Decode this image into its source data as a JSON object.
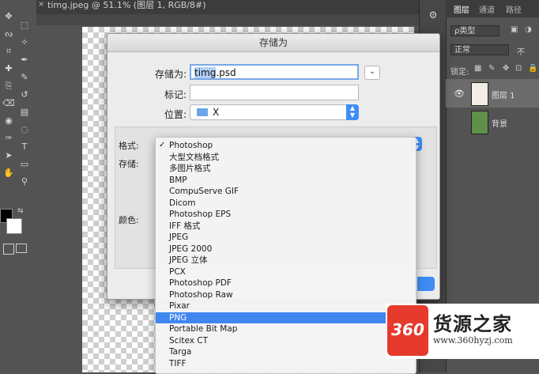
{
  "document": {
    "tab_label": "timg.jpeg @ 51.1% (图层 1, RGB/8#)"
  },
  "toolbar": {
    "tools": [
      "move-icon",
      "marquee-icon",
      "lasso-icon",
      "magic-wand-icon",
      "crop-icon",
      "eyedropper-icon",
      "healing-icon",
      "brush-icon",
      "stamp-icon",
      "history-brush-icon",
      "eraser-icon",
      "gradient-icon",
      "blur-icon",
      "dodge-icon",
      "pen-icon",
      "type-icon",
      "path-select-icon",
      "rectangle-icon",
      "hand-icon",
      "zoom-icon"
    ],
    "foreground_color": "#000000",
    "background_color": "#ffffff"
  },
  "layers_panel": {
    "tabs": [
      "图层",
      "通道",
      "路径"
    ],
    "filter": "ρ类型",
    "blend_mode": "正常",
    "opacity_label": "不",
    "lock_label": "锁定:",
    "layers": [
      {
        "name": "图层 1",
        "visible": true
      },
      {
        "name": "背景",
        "visible": false
      }
    ]
  },
  "dialog": {
    "title": "存储为",
    "save_as_label": "存储为:",
    "save_as_value": "timg.psd",
    "save_as_selected": "timg",
    "save_as_rest": ".psd",
    "tags_label": "标记:",
    "tags_value": "",
    "location_label": "位置:",
    "location_value": "X",
    "format_label": "格式:",
    "save_label": "存储:",
    "color_label": "颜色:"
  },
  "format_menu": {
    "options": [
      {
        "label": "Photoshop",
        "checked": true
      },
      {
        "label": "大型文档格式"
      },
      {
        "label": "多图片格式"
      },
      {
        "label": "BMP"
      },
      {
        "label": "CompuServe GIF"
      },
      {
        "label": "Dicom"
      },
      {
        "label": "Photoshop EPS"
      },
      {
        "label": "IFF 格式"
      },
      {
        "label": "JPEG"
      },
      {
        "label": "JPEG 2000"
      },
      {
        "label": "JPEG 立体"
      },
      {
        "label": "PCX"
      },
      {
        "label": "Photoshop PDF"
      },
      {
        "label": "Photoshop Raw"
      },
      {
        "label": "Pixar"
      },
      {
        "label": "PNG",
        "highlighted": true
      },
      {
        "label": "Portable Bit Map"
      },
      {
        "label": "Scitex CT"
      },
      {
        "label": "Targa"
      },
      {
        "label": "TIFF"
      }
    ],
    "checkmark": "✓",
    "highlight_color": "#3f86f0"
  },
  "watermark": {
    "logo_text": "360",
    "title": "货源之家",
    "url": "www.360hyzj.com"
  }
}
